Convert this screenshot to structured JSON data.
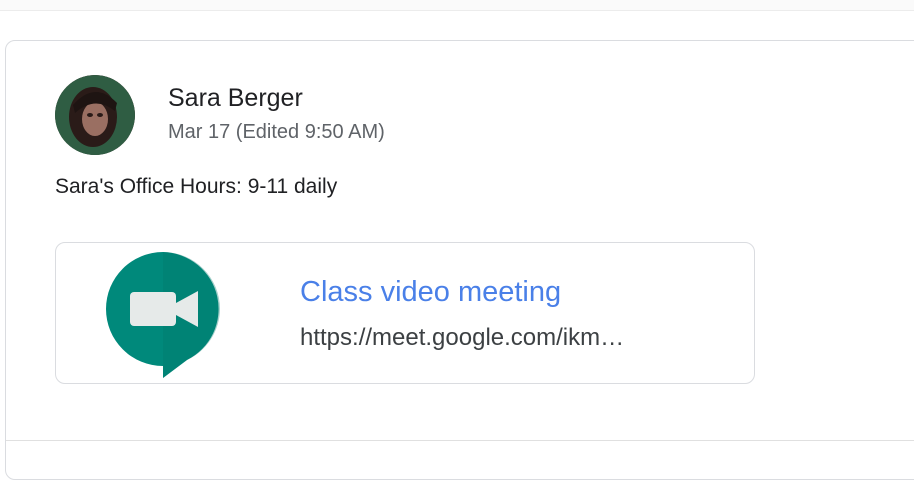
{
  "post": {
    "author_name": "Sara Berger",
    "date": "Mar 17 (Edited 9:50 AM)",
    "body": "Sara's Office Hours: 9-11 daily"
  },
  "attachment": {
    "title": "Class video meeting",
    "url": "https://meet.google.com/ikm…",
    "icon": "google-meet-icon"
  },
  "colors": {
    "meet_green": "#00897b",
    "link_blue": "#4a80e8",
    "text_primary": "#202124",
    "text_secondary": "#5f6368"
  }
}
